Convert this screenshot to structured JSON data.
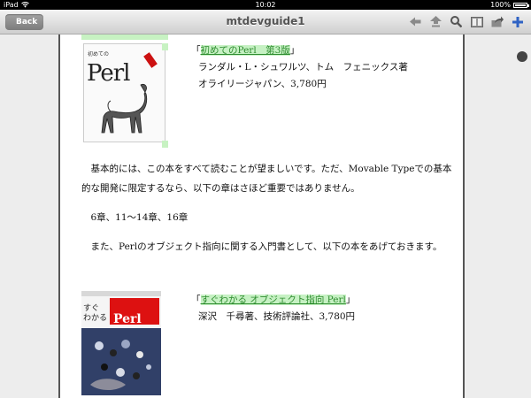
{
  "status": {
    "device": "iPad",
    "time": "10:02",
    "battery": "100%",
    "battery_level": 1.0
  },
  "nav": {
    "back_label": "Back",
    "title": "mtdevguide1"
  },
  "toolbar": {
    "icons": [
      "arrow-left-icon",
      "arrow-up-icon",
      "search-icon",
      "book-icon",
      "share-icon",
      "plus-icon"
    ]
  },
  "books": [
    {
      "cover_title": "初めての",
      "cover_word": "Perl",
      "title": "「初めてのPerl　第3版」",
      "title_link": "初めてのPerl　第3版",
      "author": "ランダル・L・シュワルツ、トム　フェニックス著",
      "publisher": "オライリージャパン、3,780円"
    },
    {
      "cover_word": "Perl",
      "title_link": "すぐわかる オブジェクト指向 Perl",
      "author": "深沢　千尋著、技術評論社、3,780円"
    }
  ],
  "paragraphs": [
    "　基本的には、この本をすべて読むことが望ましいです。ただ、Movable Typeでの基本的な開発に限定するなら、以下の章はさほど重要ではありません。",
    "　6章、11～14章、16章",
    "　また、Perlのオブジェクト指向に関する入門書として、以下の本をあげておきます。"
  ]
}
